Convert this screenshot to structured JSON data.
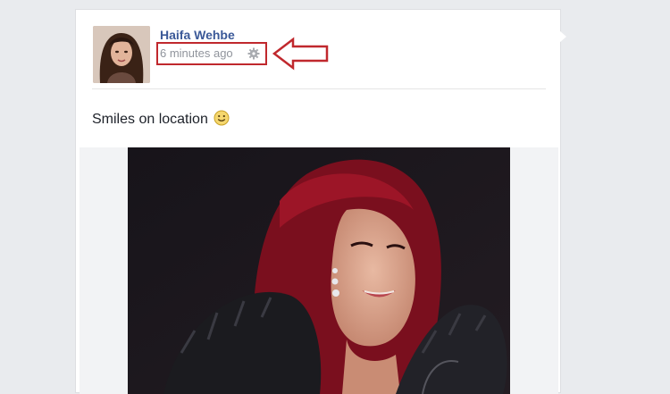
{
  "post": {
    "author_name": "Haifa Wehbe",
    "timestamp": "6 minutes ago",
    "privacy_icon": "gear-icon",
    "text": "Smiles on location",
    "emoji": "smiley-icon"
  },
  "annotation": {
    "color": "#c0282d",
    "arrow_icon": "left-arrow-icon"
  },
  "colors": {
    "author": "#3b5998",
    "meta": "#90949c",
    "background": "#e9ebee"
  }
}
